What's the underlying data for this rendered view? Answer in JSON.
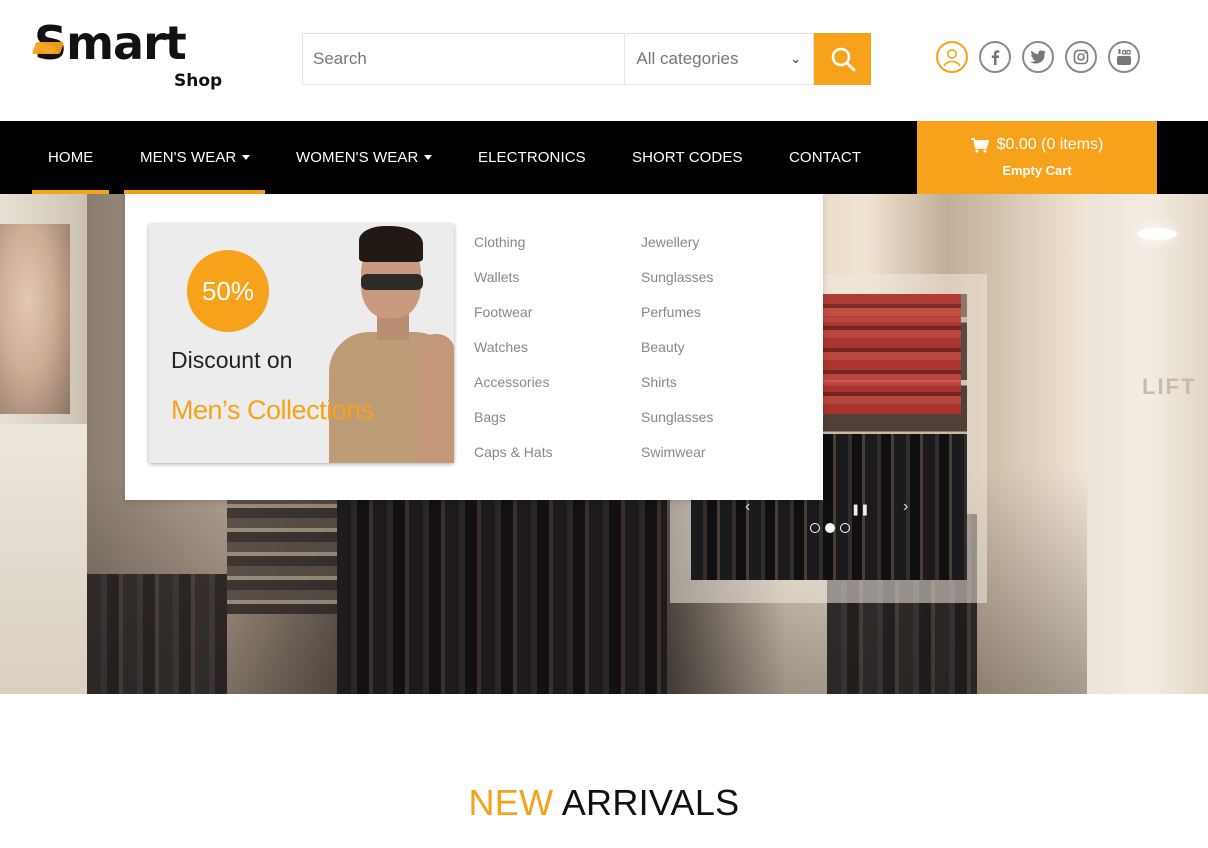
{
  "logo": {
    "word": "Smart",
    "sub": "Shop"
  },
  "search": {
    "placeholder": "Search",
    "category_selected": "All categories"
  },
  "header_icons": [
    "user-icon",
    "facebook-icon",
    "twitter-icon",
    "instagram-icon",
    "youtube-icon"
  ],
  "nav": {
    "items": [
      {
        "label": "HOME"
      },
      {
        "label": "MEN'S WEAR"
      },
      {
        "label": "WOMEN'S WEAR"
      },
      {
        "label": "ELECTRONICS"
      },
      {
        "label": "SHORT CODES"
      },
      {
        "label": "CONTACT"
      }
    ]
  },
  "cart": {
    "summary": "$0.00 (0 items)",
    "action": "Empty Cart"
  },
  "mega_menu": {
    "promo": {
      "badge": "50%",
      "line1": "Discount on",
      "line2": "Men’s Collections"
    },
    "col1": [
      "Clothing",
      "Wallets",
      "Footwear",
      "Watches",
      "Accessories",
      "Bags",
      "Caps & Hats"
    ],
    "col2": [
      "Jewellery",
      "Sunglasses",
      "Perfumes",
      "Beauty",
      "Shirts",
      "Sunglasses",
      "Swimwear"
    ]
  },
  "hero": {
    "side_sign": "LIFT",
    "active_dot": 2,
    "dot_count": 3
  },
  "section": {
    "title_accent": "NEW",
    "title_rest": "ARRIVALS"
  },
  "colors": {
    "accent": "#f7a21b",
    "nav_bg": "#000000",
    "menu_text": "#888888"
  }
}
